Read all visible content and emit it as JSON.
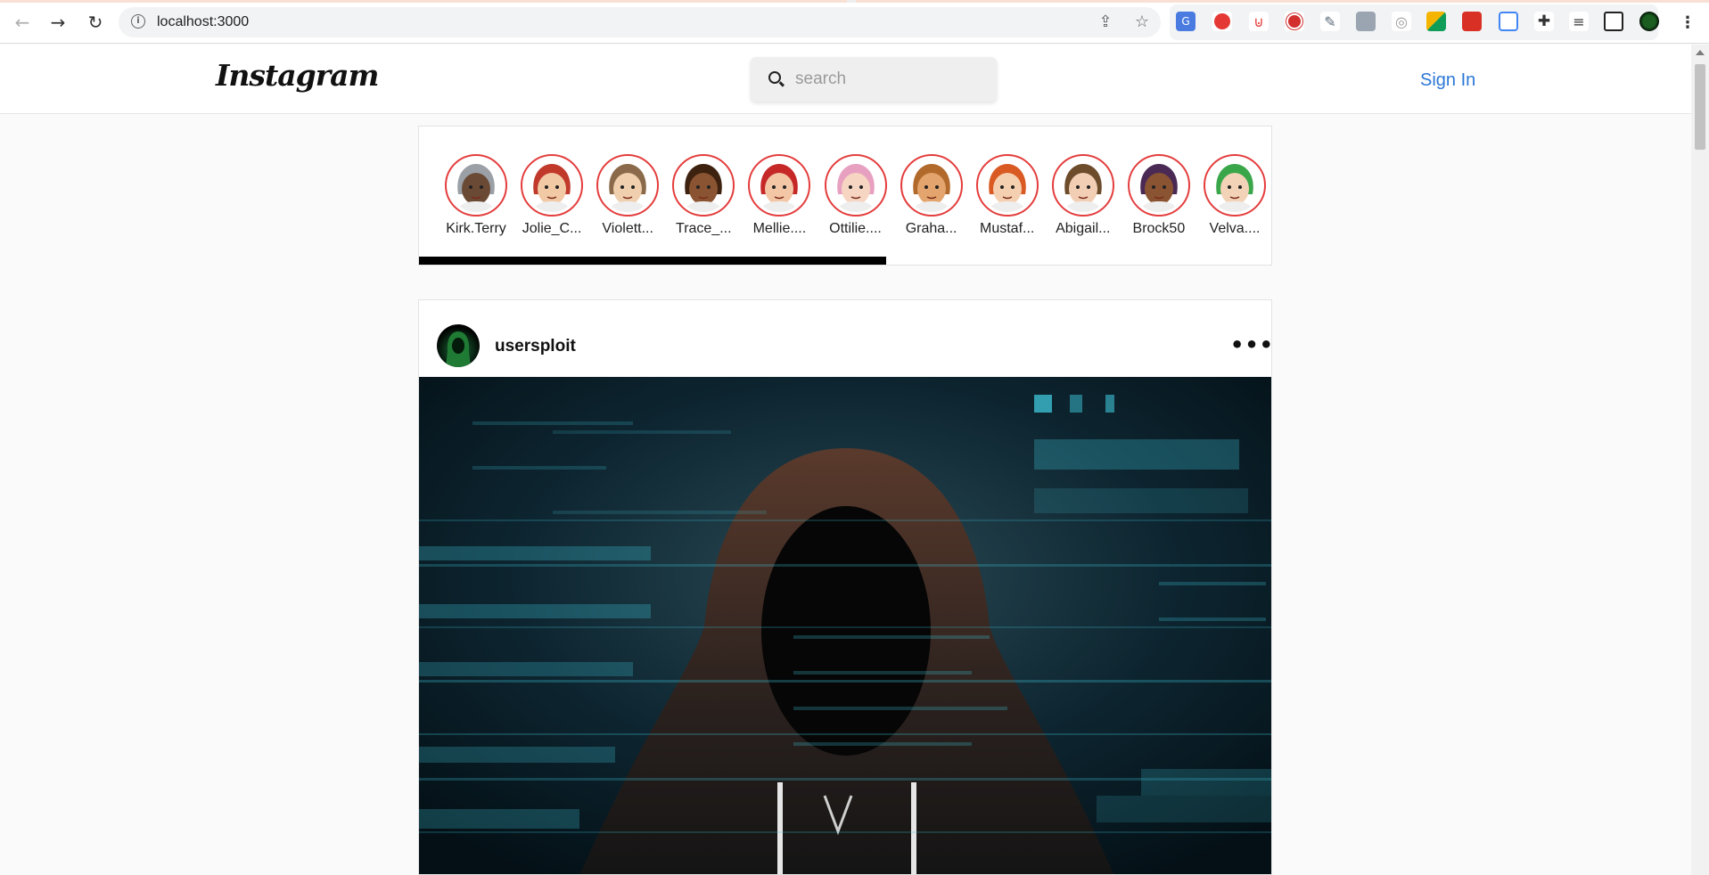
{
  "browser": {
    "url": "localhost:3000",
    "extensions": [
      "translate-icon",
      "red-shield-icon",
      "pocket-icon",
      "adblock-icon",
      "eyedropper-icon",
      "photo-icon",
      "chrome-circle-icon",
      "squares-icon",
      "paint-icon",
      "document-icon",
      "puzzle-icon",
      "media-playlist-icon",
      "sidepanel-icon",
      "profile-avatar-icon"
    ]
  },
  "header": {
    "logo": "Instagram",
    "search_placeholder": "search",
    "signin_label": "Sign In"
  },
  "stories": [
    {
      "name": "Kirk.Terry",
      "hair": "#9aa0a6",
      "skin": "#6b4a35"
    },
    {
      "name": "Jolie_C...",
      "hair": "#c0392b",
      "skin": "#f2c9a5"
    },
    {
      "name": "Violett...",
      "hair": "#8a6a4a",
      "skin": "#f0cfae"
    },
    {
      "name": "Trace_...",
      "hair": "#3d2210",
      "skin": "#8a5432"
    },
    {
      "name": "Mellie....",
      "hair": "#c62828",
      "skin": "#f3c6a6"
    },
    {
      "name": "Ottilie....",
      "hair": "#e8a0c0",
      "skin": "#f6d5c2"
    },
    {
      "name": "Graha...",
      "hair": "#b26a2c",
      "skin": "#e3a46d"
    },
    {
      "name": "Mustaf...",
      "hair": "#d95a22",
      "skin": "#f5d0b0"
    },
    {
      "name": "Abigail...",
      "hair": "#6d4c2c",
      "skin": "#f2cfb4"
    },
    {
      "name": "Brock50",
      "hair": "#4a2a55",
      "skin": "#8a5432"
    },
    {
      "name": "Velva....",
      "hair": "#3aa64a",
      "skin": "#f2d3b8"
    }
  ],
  "post": {
    "username": "usersploit",
    "more_label": "•••"
  }
}
